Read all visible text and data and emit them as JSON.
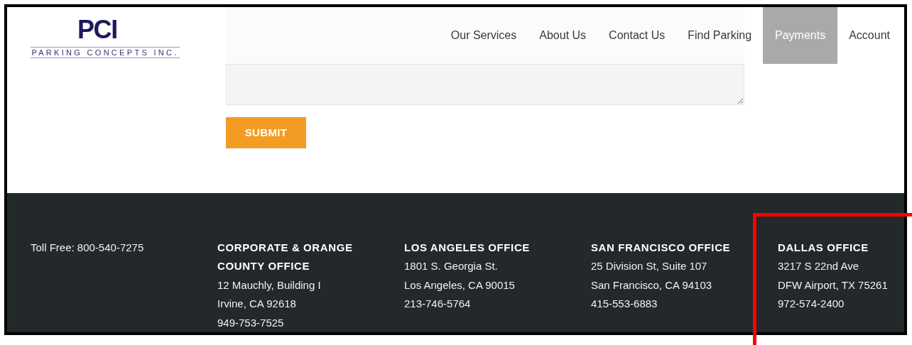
{
  "logo": {
    "mark": "PCI",
    "name": "PARKING CONCEPTS INC."
  },
  "nav": [
    {
      "label": "Our Services",
      "selected": false
    },
    {
      "label": "About Us",
      "selected": false
    },
    {
      "label": "Contact Us",
      "selected": false
    },
    {
      "label": "Find Parking",
      "selected": false
    },
    {
      "label": "Payments",
      "selected": true
    },
    {
      "label": "Account",
      "selected": false
    }
  ],
  "form": {
    "submit": "SUBMIT"
  },
  "footer": {
    "toll_free": "Toll Free: 800-540-7275",
    "offices": [
      {
        "title": "CORPORATE & ORANGE COUNTY OFFICE",
        "lines": [
          "12 Mauchly, Building I",
          "Irvine, CA 92618",
          "949-753-7525"
        ]
      },
      {
        "title": "LOS ANGELES OFFICE",
        "lines": [
          "1801 S. Georgia St.",
          "Los Angeles, CA 90015",
          "213-746-5764"
        ]
      },
      {
        "title": "SAN FRANCISCO OFFICE",
        "lines": [
          "25 Division St, Suite 107",
          "San Francisco, CA 94103",
          "415-553-6883"
        ]
      },
      {
        "title": "DALLAS OFFICE",
        "lines": [
          "3217 S 22nd Ave",
          "DFW Airport, TX 75261",
          "972-574-2400"
        ]
      }
    ]
  }
}
